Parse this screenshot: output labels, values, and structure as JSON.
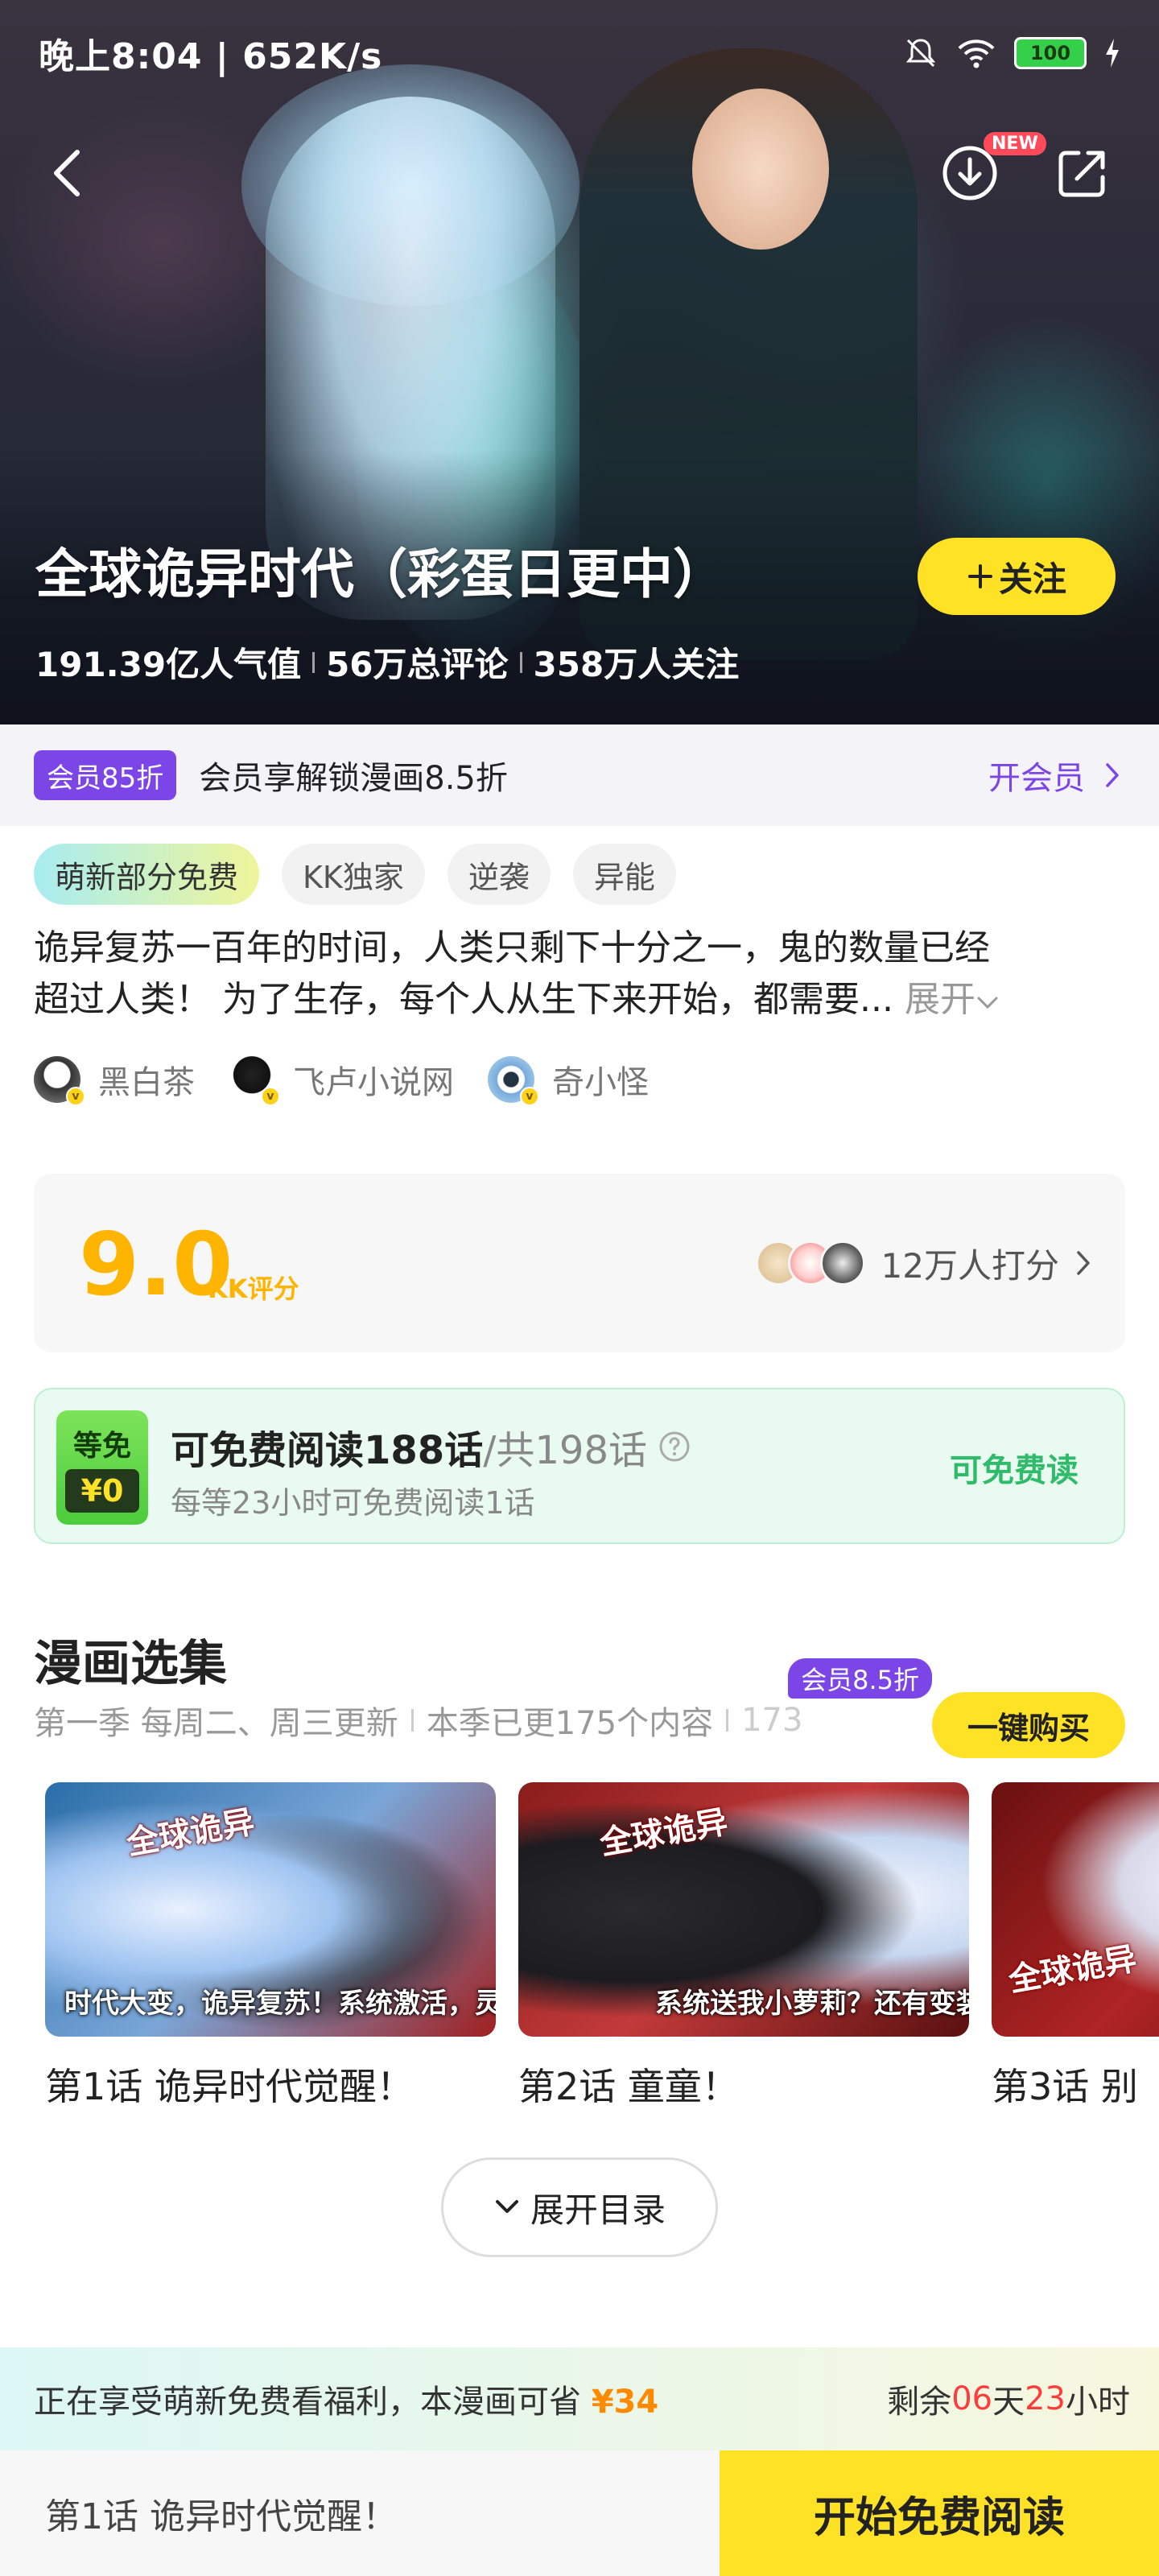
{
  "status_bar": {
    "time": "晚上8:04 | 652K/s",
    "battery": "100"
  },
  "header": {
    "new_badge": "NEW"
  },
  "hero": {
    "title": "全球诡异时代（彩蛋日更中）",
    "follow_label": "关注",
    "stats": [
      "191.39亿人气值",
      "56万总评论",
      "358万人关注"
    ]
  },
  "vip": {
    "tag": "会员85折",
    "text": "会员享解锁漫画8.5折",
    "link": "开会员"
  },
  "tags": [
    "萌新部分免费",
    "KK独家",
    "逆袭",
    "异能"
  ],
  "description": {
    "line1": "诡异复苏一百年的时间，人类只剩下十分之一，鬼的数量已经",
    "line2": "超过人类！ 为了生存，每个人从生下来开始，都需要...",
    "expand": "展开"
  },
  "authors": [
    {
      "name": "黑白茶"
    },
    {
      "name": "飞卢小说网"
    },
    {
      "name": "奇小怪"
    }
  ],
  "score": {
    "value": "9.0",
    "label": "KK评分",
    "raters": "12万人打分"
  },
  "free_read": {
    "badge_top": "等免",
    "badge_bottom": "¥0",
    "main": "可免费阅读188话",
    "total": "/共198话",
    "sub": "每等23小时可免费阅读1话",
    "action": "可免费读"
  },
  "episodes_section": {
    "title": "漫画选集",
    "sub": [
      "第一季 每周二、周三更新",
      "本季已更175个内容",
      "173"
    ],
    "buy_badge": "会员8.5折",
    "buy_label": "一键购买",
    "episodes": [
      {
        "title": "第1话 诡异时代觉醒！",
        "caption": "时代大变，诡异复苏！系统激活，灵体觉醒！",
        "logo": "全球诡异"
      },
      {
        "title": "第2话 童童！",
        "caption": "系统送我小萝莉？还有变装第二形态？",
        "logo": "全球诡异"
      },
      {
        "title": "第3话 别",
        "caption": "",
        "logo": "全球诡异"
      }
    ],
    "toc_label": "展开目录"
  },
  "benefit": {
    "text": "正在享受萌新免费看福利，本漫画可省",
    "amount": "¥34",
    "remain": "剩余",
    "days": "06",
    "days_unit": "天",
    "hours": "23",
    "hours_unit": "小时"
  },
  "bottom": {
    "last_episode": "第1话 诡异时代觉醒！",
    "start_label": "开始免费阅读"
  },
  "colors": {
    "accent_yellow": "#ffe226",
    "vip_purple": "#7b45e8",
    "score_orange": "#ffb400",
    "free_green": "#2fbb6a"
  }
}
